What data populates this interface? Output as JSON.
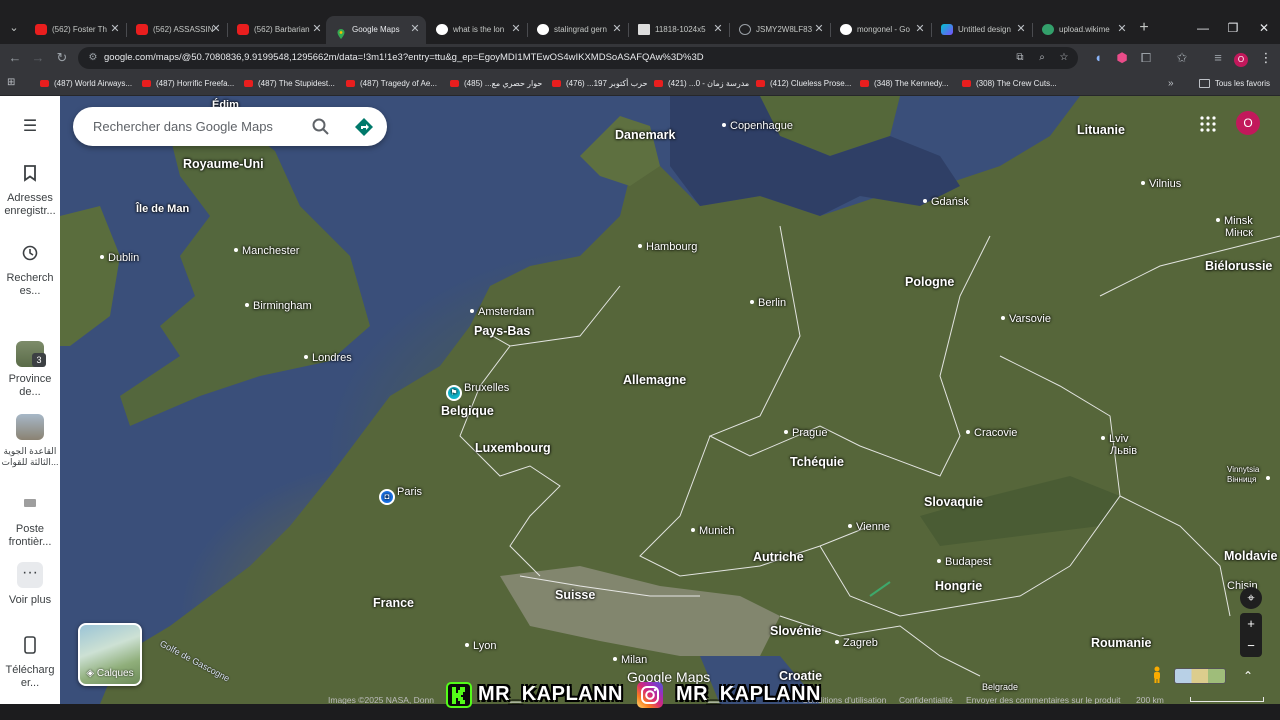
{
  "browser": {
    "tabs": [
      {
        "label": "(562) Foster Th",
        "icon": "youtube-icon",
        "color": "#e91e1e"
      },
      {
        "label": "(562) ASSASSIN",
        "icon": "youtube-icon",
        "color": "#e91e1e"
      },
      {
        "label": "(562) Barbarian",
        "icon": "youtube-icon",
        "color": "#e91e1e"
      },
      {
        "label": "Google Maps",
        "icon": "maps-pin-icon",
        "color": "#34a853",
        "active": true
      },
      {
        "label": "what is the lon",
        "icon": "google-icon",
        "color": "#ffffff"
      },
      {
        "label": "stalingrad gern",
        "icon": "google-icon",
        "color": "#ffffff"
      },
      {
        "label": "11818-1024x5",
        "icon": "image-icon",
        "color": "#ffffff"
      },
      {
        "label": "JSMY2W8LF83",
        "icon": "globe-icon",
        "color": "#9aa0a6"
      },
      {
        "label": "mongonel - Go",
        "icon": "google-icon",
        "color": "#ffffff"
      },
      {
        "label": "Untitled design",
        "icon": "canva-icon",
        "color": "#7c4dff"
      },
      {
        "label": "upload.wikime",
        "icon": "wiki-icon",
        "color": "#33a06b"
      }
    ],
    "url": "google.com/maps/@50.7080836,9.9199548,1295662m/data=!3m1!1e3?entry=ttu&g_ep=EgoyMDI1MTEwOS4wIKXMDSoASAFQAw%3D%3D",
    "bookmarks": [
      "(487) World Airways...",
      "(487) Horrific Freefa...",
      "(487) The Stupidest...",
      "(487) Tragedy of Ae...",
      "حوار حصري مع... (485)",
      "حرب أكتوبر 197... (476)",
      "مدرسة زمان - 0... (421)",
      "(412) Clueless Prose...",
      "(348) The Kennedy...",
      "(308) The Crew Cuts..."
    ],
    "all_bookmarks": "Tous les favoris",
    "bookmarks_more": "»"
  },
  "rail": {
    "saved_label": "Adresses enregistr...",
    "recents_label": "Recherch es...",
    "recent1_label": "Province de...",
    "recent1_badge": "3",
    "recent2_label": "القاعدة الجوية الثالثة للقوات...",
    "recent3_label": "Poste frontièr...",
    "more_label": "Voir plus",
    "download_label": "Télécharg er..."
  },
  "map": {
    "search_placeholder": "Rechercher dans Google Maps",
    "account_initial": "O",
    "layers_label": "Calques",
    "watermark": "Google Maps",
    "countries": {
      "uk": "Royaume-Uni",
      "denmark": "Danemark",
      "lithuania": "Lituanie",
      "netherlands": "Pays-Bas",
      "belgium": "Belgique",
      "luxembourg": "Luxembourg",
      "germany": "Allemagne",
      "poland": "Pologne",
      "belarus": "Biélorussie",
      "czechia": "Tchéquie",
      "slovakia": "Slovaquie",
      "austria": "Autriche",
      "hungary": "Hongrie",
      "switzerland": "Suisse",
      "france": "France",
      "slovenia": "Slovénie",
      "croatia": "Croatie",
      "romania": "Roumanie",
      "moldova": "Moldavie",
      "isle_of_man": "Île de Man"
    },
    "cities": {
      "copenhagen": "Copenhague",
      "vilnius": "Vilnius",
      "gdansk": "Gdańsk",
      "minsk": "Minsk",
      "minsk_local": "Мінск",
      "dublin": "Dublin",
      "manchester": "Manchester",
      "birmingham": "Birmingham",
      "london": "Londres",
      "hamburg": "Hambourg",
      "berlin": "Berlin",
      "amsterdam": "Amsterdam",
      "brussels": "Bruxelles",
      "warsaw": "Varsovie",
      "prague": "Prague",
      "krakow": "Cracovie",
      "lviv": "Lviv",
      "lviv_local": "Львів",
      "paris": "Paris",
      "munich": "Munich",
      "vienna": "Vienne",
      "budapest": "Budapest",
      "vinnytsia": "Vinnytsia",
      "vinnytsia_local": "Вінниця",
      "zagreb": "Zagreb",
      "lyon": "Lyon",
      "milan": "Milan",
      "chisinau": "Chișin",
      "belgrade": "Belgrade",
      "cut_label": "Édim"
    },
    "seas": {
      "bay_of_biscay": "Golfe de Gascogne"
    },
    "footer": {
      "imagery": "Images ©2025 NASA, Donn",
      "terms": "Conditions d'utilisation",
      "privacy": "Confidentialité",
      "feedback": "Envoyer des commentaires sur le produit",
      "scale": "200 km"
    }
  },
  "overlay": {
    "kick_handle": "MR_KAPLANN",
    "instagram_handle": "MR_KAPLANN"
  },
  "colors": {
    "directions_accent": "#00796b",
    "avatar": "#c2185b",
    "kick_green": "#53fc18",
    "instagram_gradient": "#e1306c"
  }
}
